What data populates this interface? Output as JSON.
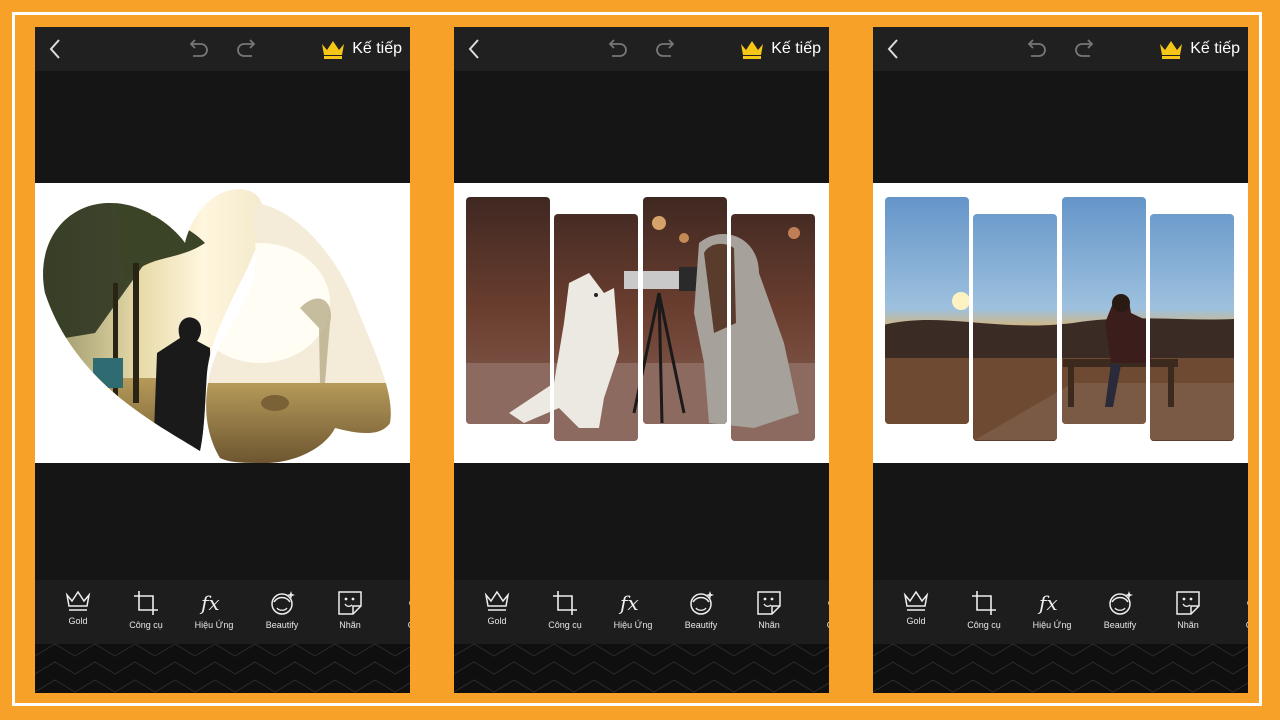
{
  "colors": {
    "accent_orange": "#f7a128",
    "crown_gold": "#f5c518",
    "phone_bg": "#151515",
    "topbar_bg": "#202020",
    "toolbar_bg": "#1d1d1d"
  },
  "screens": [
    {
      "topbar": {
        "next_label": "Kế tiếp"
      },
      "toolbar": {
        "gold": "Gold",
        "tools": "Công cụ",
        "effects": "Hiệu Ứng",
        "beautify": "Beautify",
        "sticker": "Nhãn",
        "more": "C"
      }
    },
    {
      "topbar": {
        "next_label": "Kế tiếp"
      },
      "toolbar": {
        "gold": "Gold",
        "tools": "Công cụ",
        "effects": "Hiệu Ứng",
        "beautify": "Beautify",
        "sticker": "Nhãn",
        "more": "C"
      }
    },
    {
      "topbar": {
        "next_label": "Kế tiếp"
      },
      "toolbar": {
        "gold": "Gold",
        "tools": "Công cụ",
        "effects": "Hiệu Ứng",
        "beautify": "Beautify",
        "sticker": "Nhãn",
        "more": "C"
      }
    }
  ]
}
